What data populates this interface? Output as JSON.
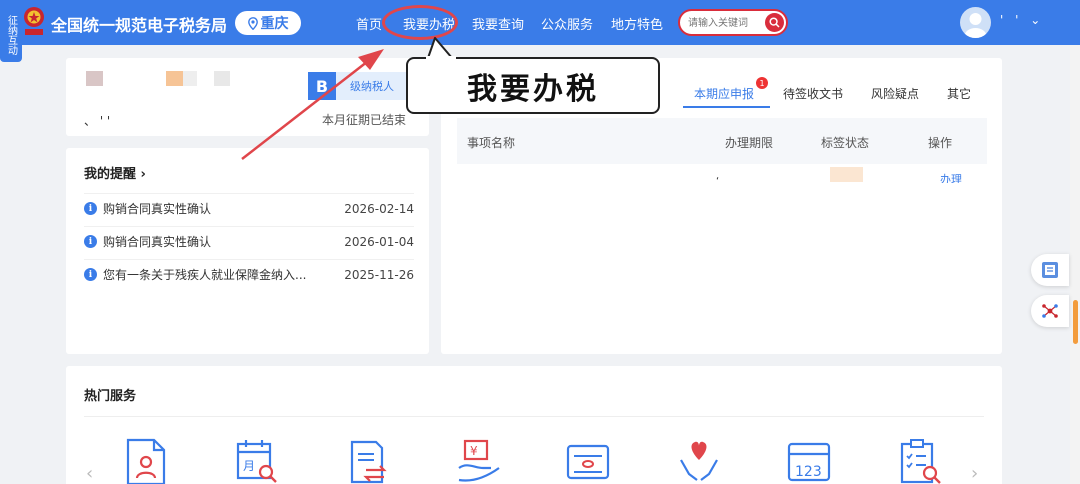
{
  "header": {
    "site_title": "全国统一规范电子税务局",
    "region": "重庆",
    "nav": [
      "首页",
      "我要办税",
      "我要查询",
      "公众服务",
      "地方特色"
    ],
    "search_placeholder": "请输入关键词",
    "user_menu": "' ' ⌄"
  },
  "side_tab": {
    "label": "征纳互动"
  },
  "profile": {
    "taxpayer_grade_badge": "B",
    "taxpayer_grade_label": "级纳税人",
    "period_status": "本月征期已结束",
    "masked_text": "、  ' '"
  },
  "reminders": {
    "title": "我的提醒 ›",
    "items": [
      {
        "text": "购销合同真实性确认",
        "date": "2026-02-14"
      },
      {
        "text": "购销合同真实性确认",
        "date": "2026-01-04"
      },
      {
        "text": "您有一条关于残疾人就业保障金纳入...",
        "date": "2025-11-26"
      }
    ]
  },
  "tasks": {
    "tabs": [
      "本期应申报",
      "待签收文书",
      "风险疑点",
      "其它"
    ],
    "active_tab_badge": "1",
    "columns": [
      "事项名称",
      "办理期限",
      "标签状态",
      "操作"
    ],
    "row_fragment": "‘",
    "row_action": "办理"
  },
  "hot_services": {
    "title": "热门服务",
    "icons": [
      "person-document-icon",
      "calendar-search-icon",
      "document-exchange-icon",
      "yuan-hand-icon",
      "certificate-icon",
      "heart-hands-icon",
      "calendar-123-icon",
      "checklist-search-icon"
    ],
    "prev": "‹",
    "next": "›"
  },
  "callout": {
    "text": "我要办税"
  },
  "colors": {
    "primary": "#3a7ce8",
    "accent_red": "#d92d3c",
    "highlight": "#e0464b"
  }
}
